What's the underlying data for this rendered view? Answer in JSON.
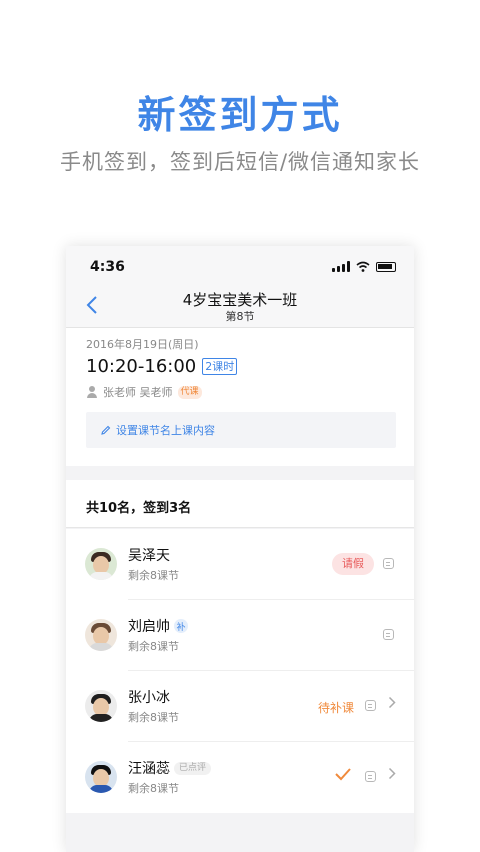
{
  "promo": {
    "headline": "新签到方式",
    "subline": "手机签到，签到后短信/微信通知家长"
  },
  "statusbar": {
    "time": "4:36"
  },
  "nav": {
    "back_icon": "chevron-left-icon",
    "title": "4岁宝宝美术一班",
    "subtitle": "第8节"
  },
  "lesson": {
    "date": "2016年8月19日(周日)",
    "time_range": "10:20-16:00",
    "hours": "2课时",
    "teachers": "张老师 吴老师",
    "substitute_tag": "代课",
    "set_content_label": "设置课节名上课内容"
  },
  "summary": {
    "count_text": "共10名，签到3名"
  },
  "students": [
    {
      "name": "吴泽天",
      "remain": "剩余8课节",
      "status": "请假"
    },
    {
      "name": "刘启帅",
      "remain": "剩余8课节",
      "tag": "补"
    },
    {
      "name": "张小冰",
      "remain": "剩余8课节",
      "status": "待补课"
    },
    {
      "name": "汪涵蕊",
      "remain": "剩余8课节",
      "tag": "已点评",
      "status_icon": "checkmark-icon"
    }
  ],
  "colors": {
    "accent": "#3f85e6",
    "leave": "#e85b5b",
    "warning": "#f08a3c"
  }
}
